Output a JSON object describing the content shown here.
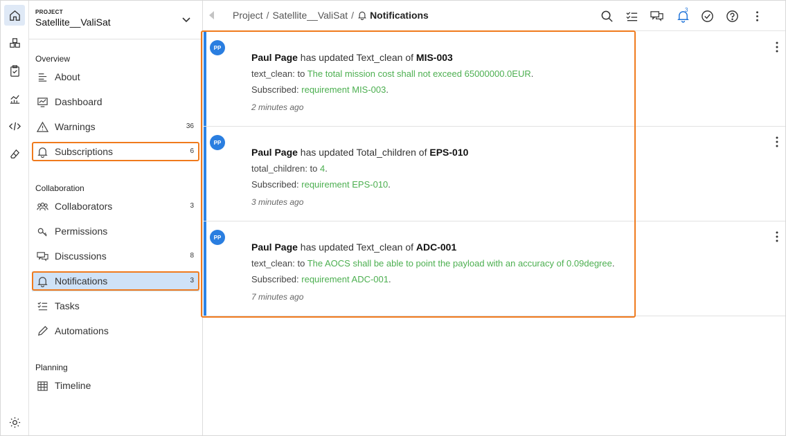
{
  "project": {
    "kicker": "PROJECT",
    "name": "Satellite__ValiSat"
  },
  "sidebar": {
    "sections": [
      {
        "title": "Overview"
      },
      {
        "title": "Collaboration"
      },
      {
        "title": "Planning"
      }
    ],
    "items": [
      {
        "label": "About",
        "count": ""
      },
      {
        "label": "Dashboard",
        "count": ""
      },
      {
        "label": "Warnings",
        "count": "36"
      },
      {
        "label": "Subscriptions",
        "count": "6"
      },
      {
        "label": "Collaborators",
        "count": "3"
      },
      {
        "label": "Permissions",
        "count": ""
      },
      {
        "label": "Discussions",
        "count": "8"
      },
      {
        "label": "Notifications",
        "count": "3"
      },
      {
        "label": "Tasks",
        "count": ""
      },
      {
        "label": "Automations",
        "count": ""
      },
      {
        "label": "Timeline",
        "count": ""
      }
    ]
  },
  "breadcrumb": {
    "root": "Project",
    "sep": "/",
    "project": "Satellite__ValiSat",
    "current": "Notifications"
  },
  "topbar": {
    "notification_count": "3"
  },
  "notifications": [
    {
      "avatar": "PP",
      "user": "Paul Page",
      "action": " has updated Text_clean of ",
      "target": "MIS-003",
      "field": "text_clean: to ",
      "value": "The total mission cost shall not exceed 65000000.0EUR",
      "value_end": ".",
      "sub_label": "Subscribed: ",
      "sub_value": "requirement MIS-003",
      "sub_end": ".",
      "time": "2 minutes ago"
    },
    {
      "avatar": "PP",
      "user": "Paul Page",
      "action": " has updated Total_children of ",
      "target": "EPS-010",
      "field": "total_children: to ",
      "value": "4",
      "value_end": ".",
      "sub_label": "Subscribed: ",
      "sub_value": "requirement EPS-010",
      "sub_end": ".",
      "time": "3 minutes ago"
    },
    {
      "avatar": "PP",
      "user": "Paul Page",
      "action": " has updated Text_clean of ",
      "target": "ADC-001",
      "field": "text_clean: to ",
      "value": "The AOCS shall be able to point the payload with an accuracy of 0.09degree",
      "value_end": ".",
      "sub_label": "Subscribed: ",
      "sub_value": "requirement ADC-001",
      "sub_end": ".",
      "time": "7 minutes ago"
    }
  ],
  "colors": {
    "accent": "#2b83e6",
    "highlight": "#f07a1c",
    "link_green": "#4caf50",
    "active_bg": "#cfe2f7"
  }
}
